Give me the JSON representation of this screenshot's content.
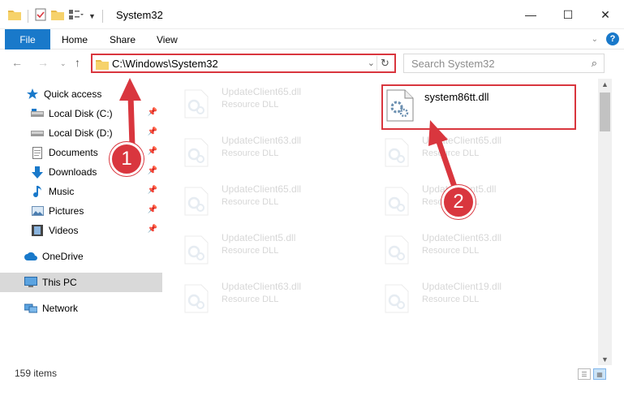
{
  "window": {
    "title": "System32",
    "minimize_glyph": "—",
    "maximize_glyph": "☐",
    "close_glyph": "✕"
  },
  "ribbon": {
    "file": "File",
    "home": "Home",
    "share": "Share",
    "view": "View"
  },
  "address": {
    "path": "C:\\Windows\\System32",
    "search_placeholder": "Search System32"
  },
  "sidebar": {
    "items": [
      {
        "label": "Quick access",
        "icon": "star-icon"
      },
      {
        "label": "Local Disk (C:)",
        "icon": "drive-icon"
      },
      {
        "label": "Local Disk (D:)",
        "icon": "drive-icon"
      },
      {
        "label": "Documents",
        "icon": "documents-icon"
      },
      {
        "label": "Downloads",
        "icon": "download-arrow-icon"
      },
      {
        "label": "Music",
        "icon": "music-note-icon"
      },
      {
        "label": "Pictures",
        "icon": "pictures-icon"
      },
      {
        "label": "Videos",
        "icon": "film-icon"
      },
      {
        "label": "OneDrive",
        "icon": "cloud-icon"
      },
      {
        "label": "This PC",
        "icon": "monitor-icon"
      },
      {
        "label": "Network",
        "icon": "network-icon"
      }
    ]
  },
  "files": [
    {
      "name": "UpdateClient65.dll",
      "type": "Resource DLL"
    },
    {
      "name": "system86tt.dll",
      "type": ""
    },
    {
      "name": "UpdateClient63.dll",
      "type": "Resource DLL"
    },
    {
      "name": "UpdateClient65.dll",
      "type": "Resource DLL"
    },
    {
      "name": "UpdateClient65.dll",
      "type": "Resource DLL"
    },
    {
      "name": "UpdateClient5.dll",
      "type": "Resource DLL"
    },
    {
      "name": "UpdateClient5.dll",
      "type": "Resource DLL"
    },
    {
      "name": "UpdateClient63.dll",
      "type": "Resource DLL"
    },
    {
      "name": "UpdateClient63.dll",
      "type": "Resource DLL"
    },
    {
      "name": "UpdateClient19.dll",
      "type": "Resource DLL"
    }
  ],
  "status": {
    "item_count": "159 items"
  },
  "annotations": {
    "step1": "1",
    "step2": "2"
  },
  "colors": {
    "accent": "#1979ca",
    "highlight_red": "#d9363e"
  }
}
